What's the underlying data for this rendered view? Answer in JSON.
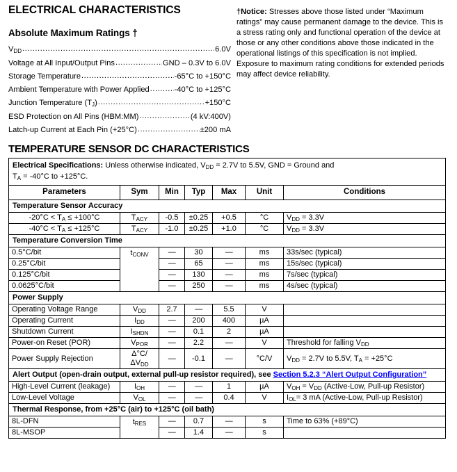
{
  "header": {
    "section_title": "ELECTRICAL CHARACTERISTICS",
    "sub_title": "Absolute Maximum Ratings †",
    "notice_label": "†Notice:",
    "notice_text": " Stresses above those listed under “Maximum ratings” may cause permanent damage to the device. This is a stress rating only and functional operation of the device at those or any other conditions above those indicated in the operational listings of this specification is not implied. Exposure to maximum rating conditions for extended periods may affect device reliability."
  },
  "ratings": [
    {
      "label": "V",
      "sub": "DD",
      "value": "6.0V"
    },
    {
      "label": "Voltage at All Input/Output Pins",
      "sub": "",
      "value": "GND – 0.3V to 6.0V"
    },
    {
      "label": "Storage Temperature",
      "sub": "",
      "value": "-65°C to +150°C"
    },
    {
      "label": "Ambient Temperature with Power Applied",
      "sub": "",
      "value": "-40°C to +125°C"
    },
    {
      "label": "Junction Temperature (T",
      "sub": "J",
      "label2": ")",
      "value": "+150°C"
    },
    {
      "label": "ESD Protection on All Pins (HBM:MM)",
      "sub": "",
      "value": "(4 kV:400V)"
    },
    {
      "label": "Latch-up Current at Each Pin (+25°C)",
      "sub": "",
      "value": "±200 mA"
    }
  ],
  "table": {
    "heading": "TEMPERATURE SENSOR DC CHARACTERISTICS",
    "spec_note_label": "Electrical Specifications:",
    "spec_note_line1_a": " Unless otherwise indicated, V",
    "spec_note_line1_sub": "DD",
    "spec_note_line1_b": " = 2.7V to 5.5V, GND = Ground and",
    "spec_note_line2_a": "T",
    "spec_note_line2_sub": "A",
    "spec_note_line2_b": " = -40°C to +125°C.",
    "columns": {
      "parameters": "Parameters",
      "sym": "Sym",
      "min": "Min",
      "typ": "Typ",
      "max": "Max",
      "unit": "Unit",
      "conditions": "Conditions"
    },
    "groups": {
      "accuracy": "Temperature Sensor Accuracy",
      "conversion": "Temperature Conversion Time",
      "power": "Power Supply",
      "alert_a": "Alert Output (open-drain output, external pull-up resistor required), see ",
      "alert_link": "Section 5.2.3 “Alert Output Configuration”",
      "thermal": "Thermal Response, from +25°C (air) to +125°C (oil bath)"
    },
    "rows": {
      "acc1": {
        "param_a": "-20°C < T",
        "param_sub": "A",
        "param_b": " ≤ +100°C",
        "sym_a": "T",
        "sym_sub": "ACY",
        "min": "-0.5",
        "typ": "±0.25",
        "max": "+0.5",
        "unit": "°C",
        "cond_a": "V",
        "cond_sub": "DD",
        "cond_b": " = 3.3V"
      },
      "acc2": {
        "param_a": "-40°C < T",
        "param_sub": "A",
        "param_b": " ≤ +125°C",
        "sym_a": "T",
        "sym_sub": "ACY",
        "min": "-1.0",
        "typ": "±0.25",
        "max": "+1.0",
        "unit": "°C",
        "cond_a": "V",
        "cond_sub": "DD",
        "cond_b": " = 3.3V"
      },
      "conv1": {
        "param": "0.5°C/bit",
        "sym_a": "t",
        "sym_sub": "CONV",
        "min": "—",
        "typ": "30",
        "max": "—",
        "unit": "ms",
        "cond": "33s/sec (typical)"
      },
      "conv2": {
        "param": "0.25°C/bit",
        "min": "—",
        "typ": "65",
        "max": "—",
        "unit": "ms",
        "cond": "15s/sec (typical)"
      },
      "conv3": {
        "param": "0.125°C/bit",
        "min": "—",
        "typ": "130",
        "max": "—",
        "unit": "ms",
        "cond": "7s/sec (typical)"
      },
      "conv4": {
        "param": "0.0625°C/bit",
        "min": "—",
        "typ": "250",
        "max": "—",
        "unit": "ms",
        "cond": "4s/sec (typical)"
      },
      "ps1": {
        "param": "Operating Voltage Range",
        "sym_a": "V",
        "sym_sub": "DD",
        "min": "2.7",
        "typ": "—",
        "max": "5.5",
        "unit": "V",
        "cond": ""
      },
      "ps2": {
        "param": "Operating Current",
        "sym_a": "I",
        "sym_sub": "DD",
        "min": "—",
        "typ": "200",
        "max": "400",
        "unit": "µA",
        "cond": ""
      },
      "ps3": {
        "param": "Shutdown Current",
        "sym_a": "I",
        "sym_sub": "SHDN",
        "min": "—",
        "typ": "0.1",
        "max": "2",
        "unit": "µA",
        "cond": ""
      },
      "ps4": {
        "param": "Power-on Reset (POR)",
        "sym_a": "V",
        "sym_sub": "POR",
        "min": "—",
        "typ": "2.2",
        "max": "—",
        "unit": "V",
        "cond_a": "Threshold for falling V",
        "cond_sub": "DD",
        "cond_b": ""
      },
      "ps5": {
        "param": "Power Supply Rejection",
        "sym_a": "Δ°C/ΔV",
        "sym_sub": "DD",
        "min": "—",
        "typ": "-0.1",
        "max": "—",
        "unit": "°C/V",
        "cond_a": "V",
        "cond_sub": "DD",
        "cond_b": " = 2.7V to 5.5V, T",
        "cond_sub2": "A",
        "cond_c": " = +25°C"
      },
      "al1": {
        "param": "High-Level Current (leakage)",
        "sym_a": "I",
        "sym_sub": "OH",
        "min": "—",
        "typ": "—",
        "max": "1",
        "unit": "µA",
        "cond_a": "V",
        "cond_sub": "OH",
        "cond_b": " = V",
        "cond_sub2": "DD",
        "cond_c": " (Active-Low, Pull-up Resistor)"
      },
      "al2": {
        "param": "Low-Level Voltage",
        "sym_a": "V",
        "sym_sub": "OL",
        "min": "—",
        "typ": "—",
        "max": "0.4",
        "unit": "V",
        "cond_a": "I",
        "cond_sub": "OL",
        "cond_b": "= 3 mA (Active-Low, Pull-up Resistor)"
      },
      "th1": {
        "param": "8L-DFN",
        "sym_a": "t",
        "sym_sub": "RES",
        "min": "—",
        "typ": "0.7",
        "max": "—",
        "unit": "s",
        "cond": "Time to 63% (+89°C)"
      },
      "th2": {
        "param": "8L-MSOP",
        "min": "—",
        "typ": "1.4",
        "max": "—",
        "unit": "s",
        "cond": ""
      }
    }
  },
  "colors": {
    "link": "#0000ff",
    "text": "#000000",
    "border": "#000000"
  }
}
